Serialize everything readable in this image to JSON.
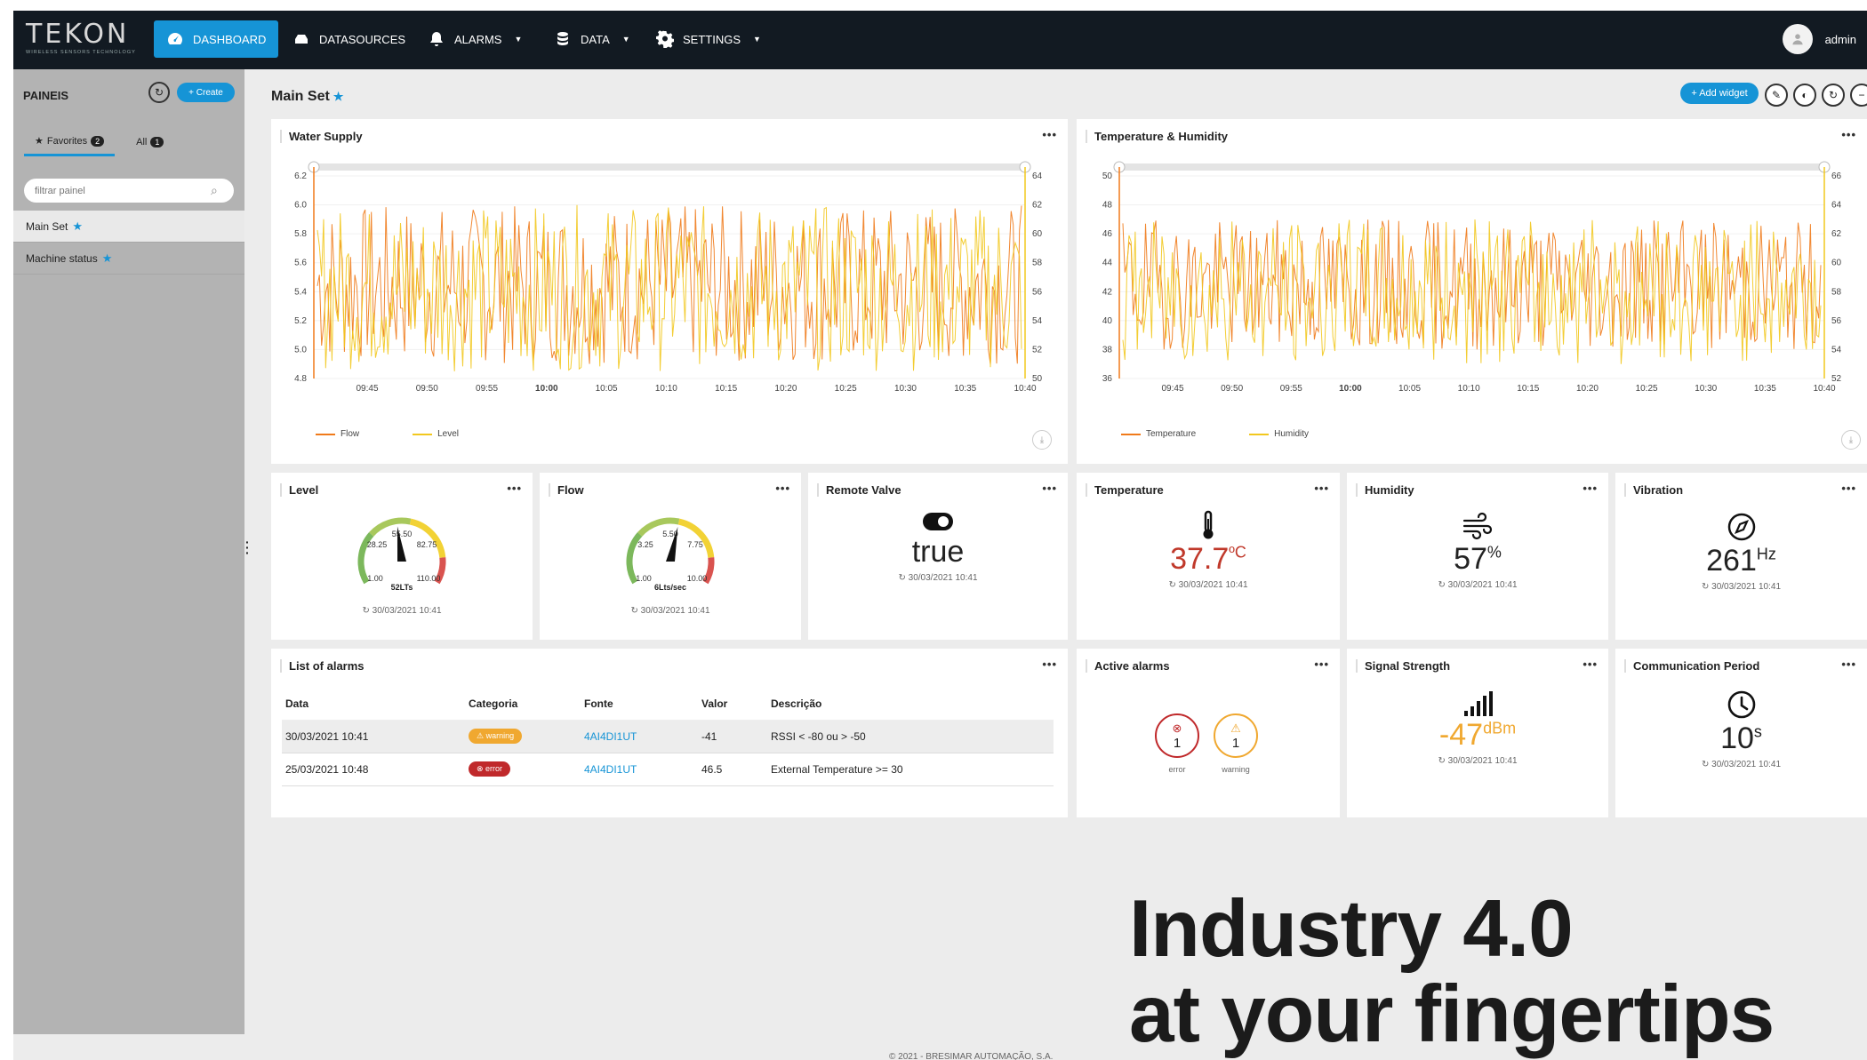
{
  "app": {
    "logo_text": "TEKON",
    "logo_tagline": "WIRELESS SENSORS TECHNOLOGY",
    "nav": [
      {
        "label": "DASHBOARD",
        "icon": "dashboard-icon"
      },
      {
        "label": "DATASOURCES",
        "icon": "datasources-icon"
      },
      {
        "label": "ALARMS",
        "icon": "bell-icon"
      },
      {
        "label": "DATA",
        "icon": "database-icon"
      },
      {
        "label": "SETTINGS",
        "icon": "gear-icon"
      }
    ],
    "user": "admin",
    "accent": "#1694d6"
  },
  "sidebar": {
    "title": "PAINEIS",
    "create_label": "+ Create",
    "tabs": [
      {
        "label": "Favorites",
        "count": "2"
      },
      {
        "label": "All",
        "count": "1"
      }
    ],
    "filter_placeholder": "filtrar painel",
    "items": [
      {
        "label": "Main Set"
      },
      {
        "label": "Machine status"
      }
    ]
  },
  "main": {
    "title": "Main Set",
    "add_widget_label": "+ Add widget"
  },
  "widgets": {
    "water_supply": {
      "title": "Water Supply"
    },
    "temp_humidity": {
      "title": "Temperature & Humidity"
    },
    "level": {
      "title": "Level",
      "value_label": "52LTs",
      "ticks": [
        "28.25",
        "55.50",
        "82.75",
        "1.00",
        "110.00"
      ],
      "timestamp": "30/03/2021 10:41",
      "fraction": 0.47
    },
    "flow": {
      "title": "Flow",
      "value_label": "6Lts/sec",
      "ticks": [
        "3.25",
        "5.50",
        "7.75",
        "1.00",
        "10.00"
      ],
      "timestamp": "30/03/2021 10:41",
      "fraction": 0.55
    },
    "remote_valve": {
      "title": "Remote Valve",
      "value": "true",
      "timestamp": "30/03/2021 10:41"
    },
    "temperature": {
      "title": "Temperature",
      "value": "37.7",
      "unit": "ºC",
      "timestamp": "30/03/2021 10:41",
      "color": "#c0392b"
    },
    "humidity": {
      "title": "Humidity",
      "value": "57",
      "unit": "%",
      "timestamp": "30/03/2021 10:41"
    },
    "vibration": {
      "title": "Vibration",
      "value": "261",
      "unit": "Hz",
      "timestamp": "30/03/2021 10:41"
    },
    "alarm_list": {
      "title": "List of alarms",
      "columns": [
        "Data",
        "Categoria",
        "Fonte",
        "Valor",
        "Descrição"
      ],
      "rows": [
        {
          "data": "30/03/2021 10:41",
          "categoria": "warning",
          "fonte": "4AI4DI1UT",
          "valor": "-41",
          "descricao": "RSSI < -80 ou > -50"
        },
        {
          "data": "25/03/2021 10:48",
          "categoria": "error",
          "fonte": "4AI4DI1UT",
          "valor": "46.5",
          "descricao": "External Temperature >= 30"
        }
      ]
    },
    "active_alarms": {
      "title": "Active alarms",
      "error_count": "1",
      "error_label": "error",
      "warning_count": "1",
      "warning_label": "warning"
    },
    "signal": {
      "title": "Signal Strength",
      "value": "-47",
      "unit": "dBm",
      "timestamp": "30/03/2021 10:41",
      "color": "#f0a830"
    },
    "comm_period": {
      "title": "Communication Period",
      "value": "10",
      "unit": "s",
      "timestamp": "30/03/2021 10:41"
    }
  },
  "chart_data": [
    {
      "type": "line",
      "title": "Water Supply",
      "x_ticks": [
        "09:45",
        "09:50",
        "09:55",
        "10:00",
        "10:05",
        "10:10",
        "10:15",
        "10:20",
        "10:25",
        "10:30",
        "10:35",
        "10:40"
      ],
      "y_left_ticks": [
        "4.8",
        "5.0",
        "5.2",
        "5.4",
        "5.6",
        "5.8",
        "6.0",
        "6.2"
      ],
      "y_right_ticks": [
        "50",
        "52",
        "54",
        "56",
        "58",
        "60",
        "62",
        "64"
      ],
      "series": [
        {
          "name": "Flow",
          "color": "#f07a1a",
          "range": [
            4.9,
            6.0
          ]
        },
        {
          "name": "Level",
          "color": "#f2c81e",
          "range": [
            50.5,
            62
          ]
        }
      ]
    },
    {
      "type": "line",
      "title": "Temperature & Humidity",
      "x_ticks": [
        "09:45",
        "09:50",
        "09:55",
        "10:00",
        "10:05",
        "10:10",
        "10:15",
        "10:20",
        "10:25",
        "10:30",
        "10:35",
        "10:40"
      ],
      "y_left_ticks": [
        "36",
        "38",
        "40",
        "42",
        "44",
        "46",
        "48",
        "50"
      ],
      "y_right_ticks": [
        "52",
        "54",
        "56",
        "58",
        "60",
        "62",
        "64",
        "66"
      ],
      "series": [
        {
          "name": "Temperature",
          "color": "#f07a1a",
          "range": [
            38,
            47
          ]
        },
        {
          "name": "Humidity",
          "color": "#f2c81e",
          "range": [
            53,
            63
          ]
        }
      ]
    }
  ],
  "slogan": {
    "line1": "Industry 4.0",
    "line2": "at your fingertips"
  },
  "footer": "© 2021 - BRESIMAR AUTOMAÇÃO, S.A."
}
